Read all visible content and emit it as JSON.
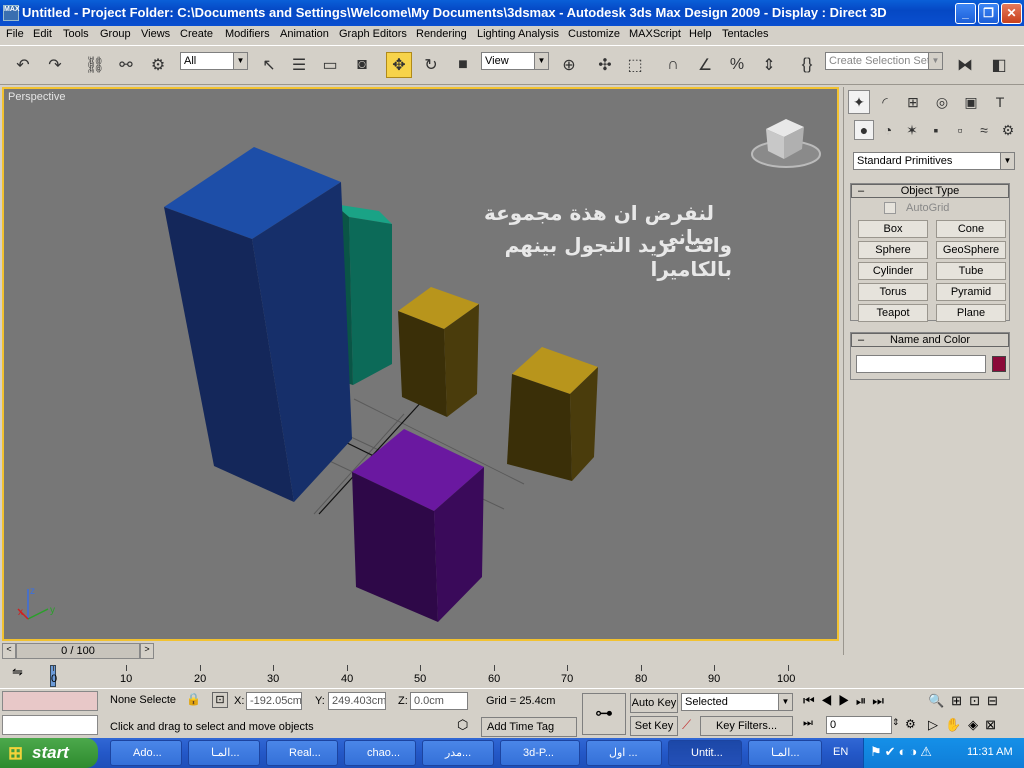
{
  "titlebar": {
    "title": "Untitled      - Project Folder: C:\\Documents and Settings\\Welcome\\My Documents\\3dsmax      - Autodesk 3ds Max Design 2009      - Display : Direct 3D",
    "minimize": "_",
    "restore": "❐",
    "close": "✕"
  },
  "menu": [
    "File",
    "Edit",
    "Tools",
    "Group",
    "Views",
    "Create",
    "Modifiers",
    "Animation",
    "Graph Editors",
    "Rendering",
    "Lighting Analysis",
    "Customize",
    "MAXScript",
    "Help",
    "Tentacles"
  ],
  "toolbar": {
    "filter_value": "All",
    "coord_value": "View",
    "selection_set_placeholder": "Create Selection Set"
  },
  "viewport": {
    "label": "Perspective",
    "overlay_line1": "لنفرض ان هذة مجموعة مباني",
    "overlay_line2": "وانت تريد التجول بينهم بالكاميرا",
    "axis_z": "z",
    "axis_x": "x",
    "axis_y": "y",
    "colors": {
      "blue": "#1d3f8c",
      "teal": "#118b72",
      "yellow": "#a8891a",
      "purple": "#5b1380",
      "bg": "#777777"
    }
  },
  "cmdpanel": {
    "dropdown": "Standard Primitives",
    "object_type_title": "Object Type",
    "autogrid": "AutoGrid",
    "buttons": [
      "Box",
      "Cone",
      "Sphere",
      "GeoSphere",
      "Cylinder",
      "Tube",
      "Torus",
      "Pyramid",
      "Teapot",
      "Plane"
    ],
    "name_color_title": "Name and Color",
    "swatch_color": "#8b0a3a"
  },
  "timeline": {
    "frame_label": "0 / 100",
    "ticks": [
      "0",
      "10",
      "20",
      "30",
      "40",
      "50",
      "60",
      "70",
      "80",
      "90",
      "100"
    ]
  },
  "status": {
    "selection": "None Selecte",
    "x_label": "X:",
    "x_value": "-192.05cm",
    "y_label": "Y:",
    "y_value": "249.403cm",
    "z_label": "Z:",
    "z_value": "0.0cm",
    "grid": "Grid = 25.4cm",
    "prompt": "Click and drag to select and move objects",
    "add_time_tag": "Add Time Tag",
    "auto_key": "Auto Key",
    "set_key": "Set Key",
    "selected": "Selected",
    "key_filters": "Key Filters...",
    "frame": "0"
  },
  "taskbar": {
    "start": "start",
    "tasks": [
      "Ado...",
      "المـا...",
      "Real...",
      "chao...",
      "مدر...",
      "3d-P...",
      "اول ...",
      "Untit...",
      "المـا..."
    ],
    "lang": "EN",
    "clock": "11:31 AM"
  }
}
